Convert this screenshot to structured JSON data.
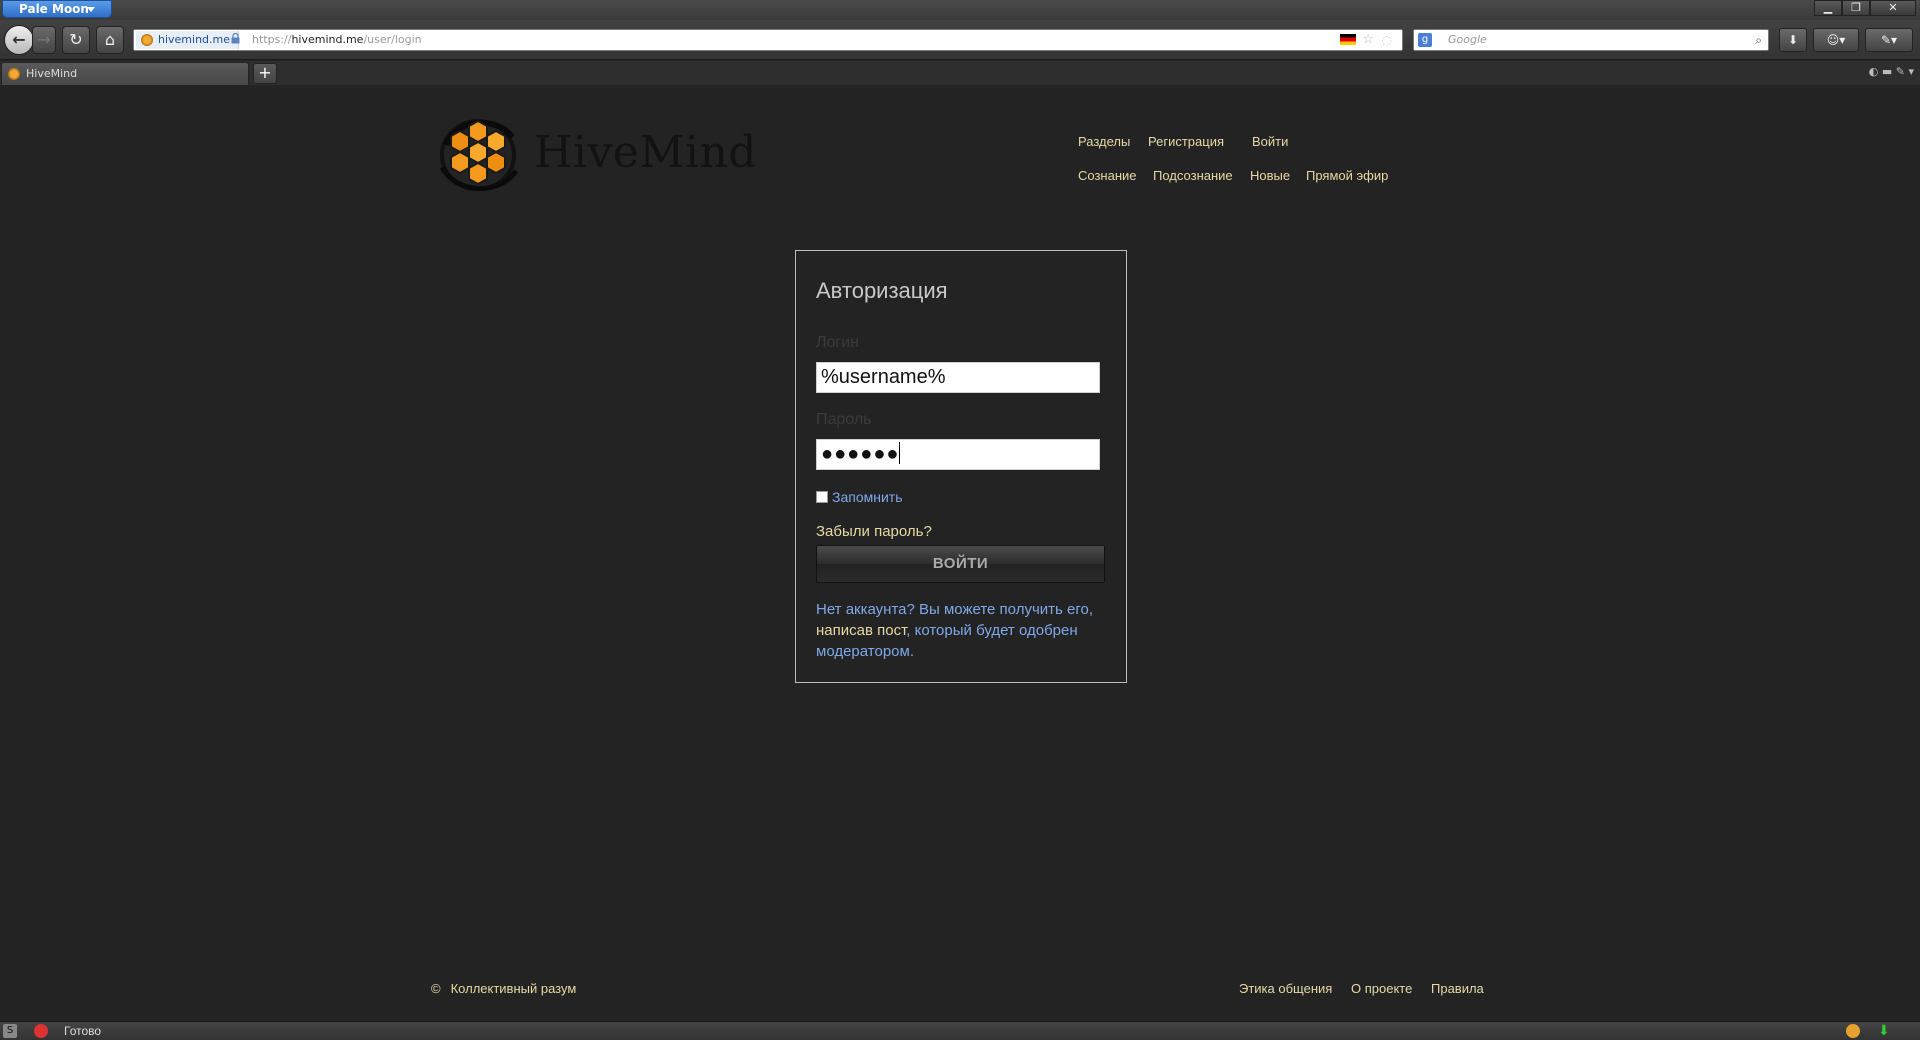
{
  "browser": {
    "app_menu": "Pale Moon",
    "tab_title": "HiveMind",
    "new_tab": "+",
    "site_identity": "hivemind.me",
    "url_scheme": "https://",
    "url_host": "hivemind.me",
    "url_path": "/user/login",
    "search_placeholder": "Google",
    "status_text": "Готово"
  },
  "site": {
    "logo_text": "HiveMind",
    "nav_top": [
      "Разделы",
      "Регистрация",
      "Войти"
    ],
    "nav_bottom": [
      "Сознание",
      "Подсознание",
      "Новые",
      "Прямой эфир"
    ]
  },
  "login": {
    "title": "Авторизация",
    "login_label": "Логин",
    "login_value": "%username%",
    "password_label": "Пароль",
    "password_mask": "●●●●●●",
    "remember_label": "Запомнить",
    "remember_checked": false,
    "forgot_link": "Забыли пароль?",
    "submit_label": "ВОЙТИ",
    "signup_part1": "Нет аккаунта? Вы можете получить его, ",
    "signup_link": "написав пост",
    "signup_part2": ", который будет одобрен модератором."
  },
  "footer": {
    "copyright_symbol": "©",
    "copyright_text": "Коллективный разум",
    "links": [
      "Этика общения",
      "О проекте",
      "Правила"
    ]
  }
}
